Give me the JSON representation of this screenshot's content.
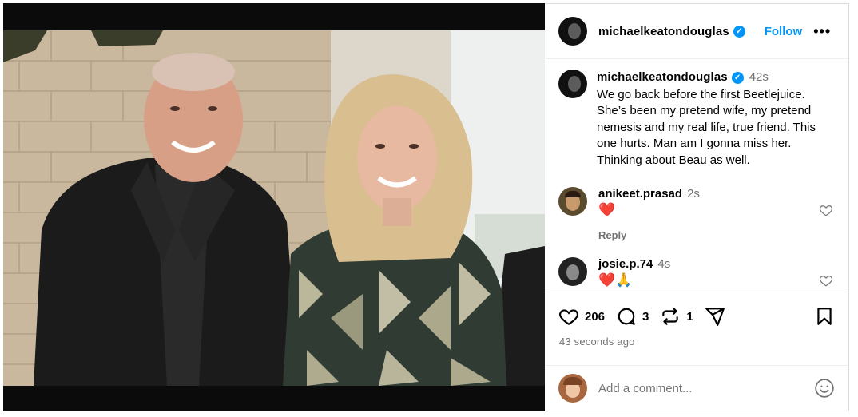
{
  "post": {
    "author": "michaelkeatondouglas",
    "follow_label": "Follow",
    "more_icon": "more-dots-icon",
    "caption_time": "42s",
    "caption_text": "We go back before the first Beetlejuice. She’s been my pretend wife, my pretend nemesis and my real life, true friend. This one hurts. Man am I gonna miss her. Thinking about Beau as well."
  },
  "comments": [
    {
      "user": "anikeet.prasad",
      "time": "2s",
      "text": "❤️",
      "reply_label": "Reply"
    },
    {
      "user": "josie.p.74",
      "time": "4s",
      "text": "❤️🙏"
    }
  ],
  "actions": {
    "likes": "206",
    "comments": "3",
    "reposts": "1",
    "icons": [
      "heart-icon",
      "comment-icon",
      "repost-icon",
      "share-icon",
      "bookmark-icon"
    ]
  },
  "timestamp": "43 seconds ago",
  "add_comment": {
    "placeholder": "Add a comment..."
  },
  "colors": {
    "accent": "#0095f6",
    "muted": "#737373",
    "heart": "#e0245e"
  }
}
